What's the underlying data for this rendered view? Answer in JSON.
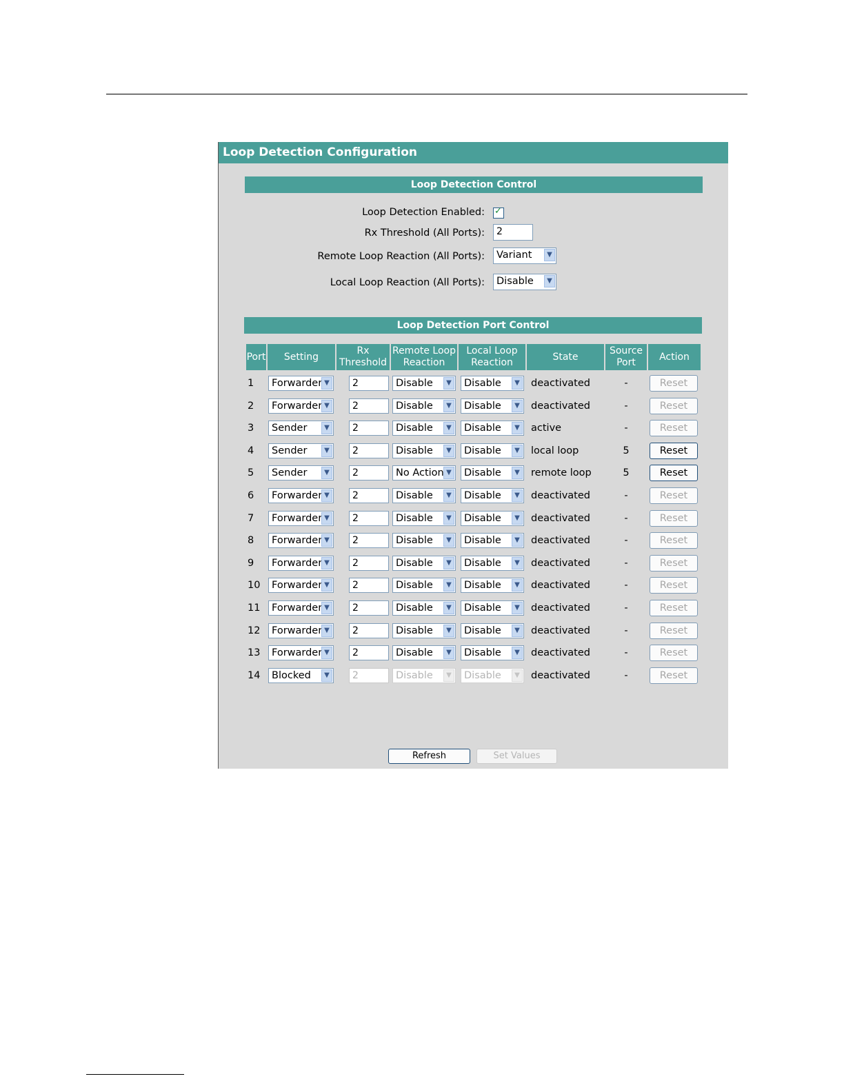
{
  "panel_title": "Loop Detection Configuration",
  "control": {
    "section_title": "Loop Detection Control",
    "enabled_label": "Loop Detection Enabled:",
    "enabled_checked": true,
    "rx_label": "Rx Threshold (All Ports):",
    "rx_value": "2",
    "remote_label": "Remote Loop Reaction (All Ports):",
    "remote_value": "Variant",
    "local_label": "Local Loop Reaction (All Ports):",
    "local_value": "Disable"
  },
  "port_control": {
    "section_title": "Loop Detection Port Control",
    "headers": {
      "port": "Port",
      "setting": "Setting",
      "rx_1": "Rx",
      "rx_2": "Threshold",
      "remote_1": "Remote Loop",
      "remote_2": "Reaction",
      "local_1": "Local Loop",
      "local_2": "Reaction",
      "state": "State",
      "source_1": "Source",
      "source_2": "Port",
      "action": "Action"
    },
    "rows": [
      {
        "port": "1",
        "setting": "Forwarder",
        "rx": "2",
        "remote": "Disable",
        "local": "Disable",
        "state": "deactivated",
        "source": "-",
        "action": "Reset",
        "action_active": false,
        "fields_disabled": false
      },
      {
        "port": "2",
        "setting": "Forwarder",
        "rx": "2",
        "remote": "Disable",
        "local": "Disable",
        "state": "deactivated",
        "source": "-",
        "action": "Reset",
        "action_active": false,
        "fields_disabled": false
      },
      {
        "port": "3",
        "setting": "Sender",
        "rx": "2",
        "remote": "Disable",
        "local": "Disable",
        "state": "active",
        "source": "-",
        "action": "Reset",
        "action_active": false,
        "fields_disabled": false
      },
      {
        "port": "4",
        "setting": "Sender",
        "rx": "2",
        "remote": "Disable",
        "local": "Disable",
        "state": "local loop",
        "source": "5",
        "action": "Reset",
        "action_active": true,
        "fields_disabled": false
      },
      {
        "port": "5",
        "setting": "Sender",
        "rx": "2",
        "remote": "No Action",
        "local": "Disable",
        "state": "remote loop",
        "source": "5",
        "action": "Reset",
        "action_active": true,
        "fields_disabled": false
      },
      {
        "port": "6",
        "setting": "Forwarder",
        "rx": "2",
        "remote": "Disable",
        "local": "Disable",
        "state": "deactivated",
        "source": "-",
        "action": "Reset",
        "action_active": false,
        "fields_disabled": false
      },
      {
        "port": "7",
        "setting": "Forwarder",
        "rx": "2",
        "remote": "Disable",
        "local": "Disable",
        "state": "deactivated",
        "source": "-",
        "action": "Reset",
        "action_active": false,
        "fields_disabled": false
      },
      {
        "port": "8",
        "setting": "Forwarder",
        "rx": "2",
        "remote": "Disable",
        "local": "Disable",
        "state": "deactivated",
        "source": "-",
        "action": "Reset",
        "action_active": false,
        "fields_disabled": false
      },
      {
        "port": "9",
        "setting": "Forwarder",
        "rx": "2",
        "remote": "Disable",
        "local": "Disable",
        "state": "deactivated",
        "source": "-",
        "action": "Reset",
        "action_active": false,
        "fields_disabled": false
      },
      {
        "port": "10",
        "setting": "Forwarder",
        "rx": "2",
        "remote": "Disable",
        "local": "Disable",
        "state": "deactivated",
        "source": "-",
        "action": "Reset",
        "action_active": false,
        "fields_disabled": false
      },
      {
        "port": "11",
        "setting": "Forwarder",
        "rx": "2",
        "remote": "Disable",
        "local": "Disable",
        "state": "deactivated",
        "source": "-",
        "action": "Reset",
        "action_active": false,
        "fields_disabled": false
      },
      {
        "port": "12",
        "setting": "Forwarder",
        "rx": "2",
        "remote": "Disable",
        "local": "Disable",
        "state": "deactivated",
        "source": "-",
        "action": "Reset",
        "action_active": false,
        "fields_disabled": false
      },
      {
        "port": "13",
        "setting": "Forwarder",
        "rx": "2",
        "remote": "Disable",
        "local": "Disable",
        "state": "deactivated",
        "source": "-",
        "action": "Reset",
        "action_active": false,
        "fields_disabled": false
      },
      {
        "port": "14",
        "setting": "Blocked",
        "rx": "2",
        "remote": "Disable",
        "local": "Disable",
        "state": "deactivated",
        "source": "-",
        "action": "Reset",
        "action_active": false,
        "fields_disabled": true
      }
    ]
  },
  "footer": {
    "refresh_label": "Refresh",
    "set_values_label": "Set Values",
    "set_values_enabled": false
  },
  "colors": {
    "header_teal": "#4a9f99",
    "panel_gray": "#d9d9d9"
  }
}
